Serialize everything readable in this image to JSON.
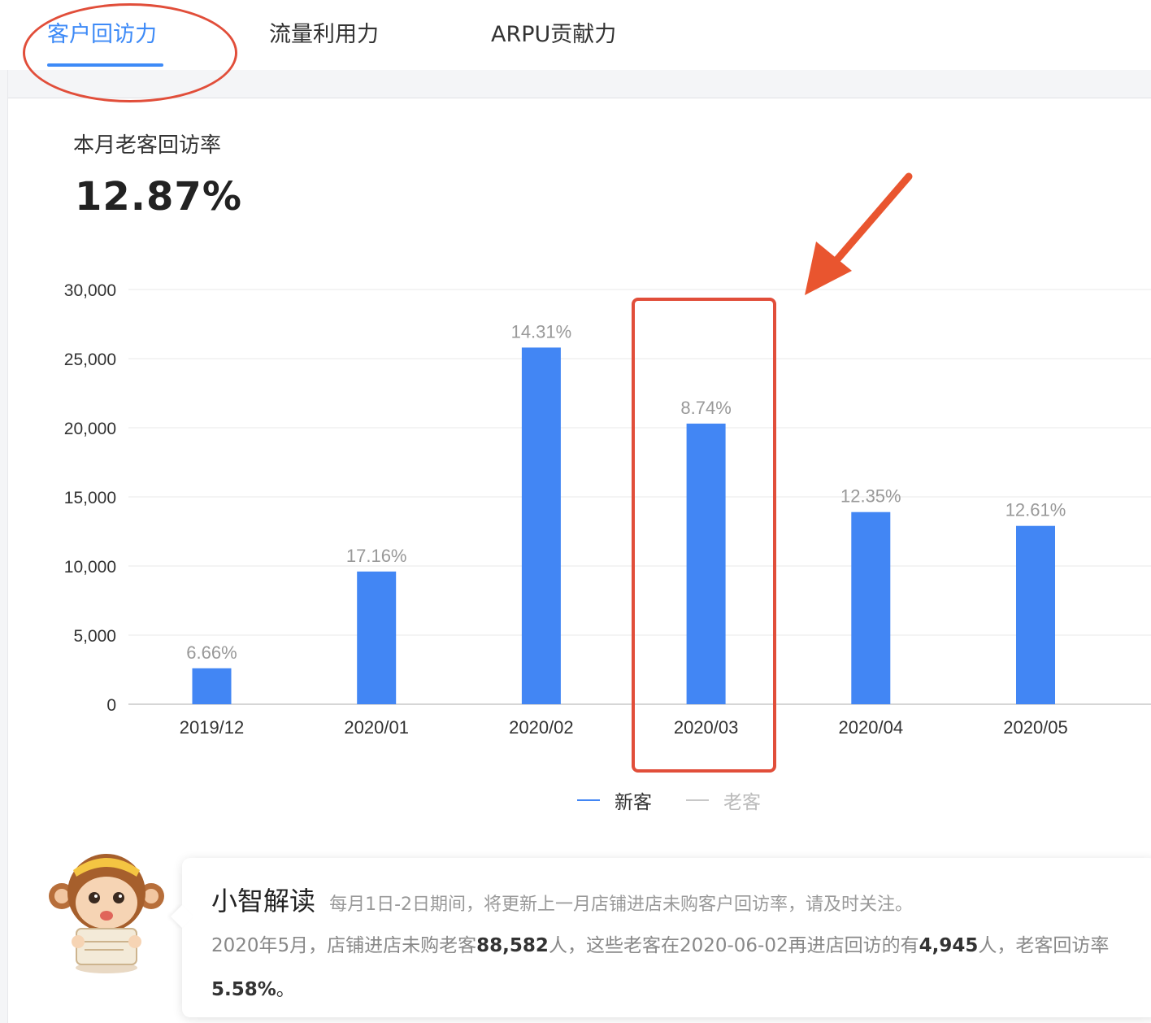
{
  "tabs": {
    "items": [
      "客户回访力",
      "流量利用力",
      "ARPU贡献力"
    ],
    "active_index": 0
  },
  "metric": {
    "title": "本月老客回访率",
    "value": "12.87%"
  },
  "chart_data": {
    "type": "bar",
    "categories": [
      "2019/12",
      "2020/01",
      "2020/02",
      "2020/03",
      "2020/04",
      "2020/05"
    ],
    "series": [
      {
        "name": "新客",
        "values": [
          2600,
          9600,
          25800,
          20300,
          13900,
          12900
        ],
        "color": "#4286f4"
      }
    ],
    "data_labels": [
      "6.66%",
      "17.16%",
      "14.31%",
      "8.74%",
      "12.35%",
      "12.61%"
    ],
    "ylim": [
      0,
      30000
    ],
    "yticks": [
      0,
      5000,
      10000,
      15000,
      20000,
      25000,
      30000
    ],
    "ytick_labels": [
      "0",
      "5,000",
      "10,000",
      "15,000",
      "20,000",
      "25,000",
      "30,000"
    ],
    "grid": true,
    "legend": [
      {
        "name": "新客",
        "color": "#4286f4",
        "active": true
      },
      {
        "name": "老客",
        "color": "#c8c8c8",
        "active": false
      }
    ],
    "legend_position": "bottom-center",
    "highlight_category": "2020/03"
  },
  "insight": {
    "name": "小智解读",
    "note": "每月1日-2日期间，将更新上一月店铺进店未购客户回访率，请及时关注。",
    "line2_prefix": "2020年5月，店铺进店未购老客",
    "line2_count1": "88,582",
    "line2_mid": "人，这些老客在2020-06-02再进店回访的有",
    "line2_count2": "4,945",
    "line2_suffix": "人，老客回访率",
    "line3_value": "5.58%",
    "line3_suffix": "。"
  },
  "colors": {
    "accent": "#3d8af7",
    "bar": "#4286f4",
    "annotation": "#e14e3a"
  }
}
